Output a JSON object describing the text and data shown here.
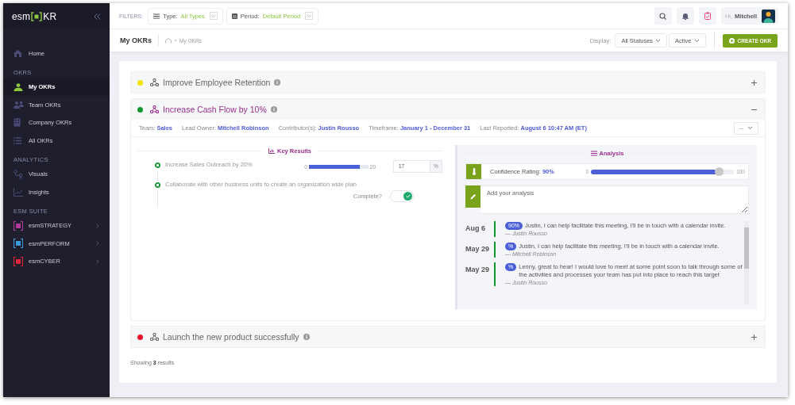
{
  "sidebar": {
    "logo": {
      "prefix": "esm",
      "suffix": "KR"
    },
    "items": [
      {
        "kind": "link",
        "label": "Home",
        "selected": false
      },
      {
        "kind": "section",
        "label": "OKRS"
      },
      {
        "kind": "link",
        "label": "My OKRs",
        "selected": true
      },
      {
        "kind": "link",
        "label": "Team OKRs",
        "selected": false
      },
      {
        "kind": "link",
        "label": "Company OKRs",
        "selected": false
      },
      {
        "kind": "link",
        "label": "All OKRs",
        "selected": false
      },
      {
        "kind": "section",
        "label": "ANALYTICS"
      },
      {
        "kind": "link",
        "label": "Visuals",
        "selected": false
      },
      {
        "kind": "link",
        "label": "Insights",
        "selected": false
      },
      {
        "kind": "section",
        "label": "ESM SUITE"
      },
      {
        "kind": "app",
        "label": "esmSTRATEGY",
        "selected": false,
        "color": "#b0399c"
      },
      {
        "kind": "app",
        "label": "esmPERFORM",
        "selected": false,
        "color": "#3b9ad9"
      },
      {
        "kind": "app",
        "label": "esmCYBER",
        "selected": false,
        "color": "#d9243a"
      }
    ]
  },
  "header": {
    "filters_label": "FILTERS:",
    "filters": [
      {
        "label": "Type:",
        "value": "All Types"
      },
      {
        "label": "Period:",
        "value": "Default Period"
      }
    ],
    "greeting": "Hi,",
    "user": "Mitchell"
  },
  "subheader": {
    "title": "My OKRs",
    "breadcrumb": [
      "My OKRs"
    ],
    "display_label": "Display:",
    "dropdowns": [
      "All Statuses",
      "Active"
    ],
    "create_button": "CREATE OKR"
  },
  "objectives": [
    {
      "title": "Improve Employee Retention",
      "color": "#f2e600",
      "expanded": false
    },
    {
      "title": "Increase Cash Flow by 10%",
      "color": "#13952f",
      "expanded": true,
      "details": {
        "meta": [
          {
            "label": "Team:",
            "value": "Sales"
          },
          {
            "label": "Lead Owner:",
            "value": "Mitchell Robinson"
          },
          {
            "label": "Contributor(s):",
            "value": "Justin Rousso"
          },
          {
            "label": "Timeframe:",
            "value": "January 1 - December 31"
          },
          {
            "label": "Last Reported:",
            "value": "August 6 10:47 AM (ET)"
          }
        ],
        "action": "--",
        "key_results_title": "Key Results",
        "key_results": [
          {
            "kind": "progress",
            "text": "Increase Sales Outreach by 20%",
            "min": "0",
            "max": "20",
            "level": 0.85,
            "value": "17",
            "unit": "%"
          },
          {
            "kind": "toggle",
            "text": "Collaborate with other business units to create an organization wide plan",
            "toggle_label": "Complete?",
            "checked": true
          }
        ],
        "analysis": {
          "title": "Analysis",
          "confidence_label": "Confidence Rating:",
          "confidence_value": "90%",
          "min": "0",
          "max": "100",
          "level": 0.9,
          "placeholder": "Add your analysis",
          "entries": [
            {
              "date": "Aug 6",
              "badge": "90%",
              "text": "Justin, I can help facilitate this meeting, I'll be in touch with a calendar invite.",
              "author": "— Justin Rousso"
            },
            {
              "date": "May 29",
              "badge": "%",
              "text": "Justin, I can help facilitate this meeting, I'll be in touch with a calendar invite.",
              "author": "— Mitchell Robinson"
            },
            {
              "date": "May 29",
              "badge": "%",
              "text": "Lenny, great to hear! I would love to meet at some point soon to talk through some of the activities and processes your team has put into place to reach this target",
              "author": "— Justin Rousso"
            }
          ]
        }
      }
    },
    {
      "title": "Launch the new product successfully",
      "color": "#e8102c",
      "expanded": false
    }
  ],
  "footer": "Showing **3** results"
}
